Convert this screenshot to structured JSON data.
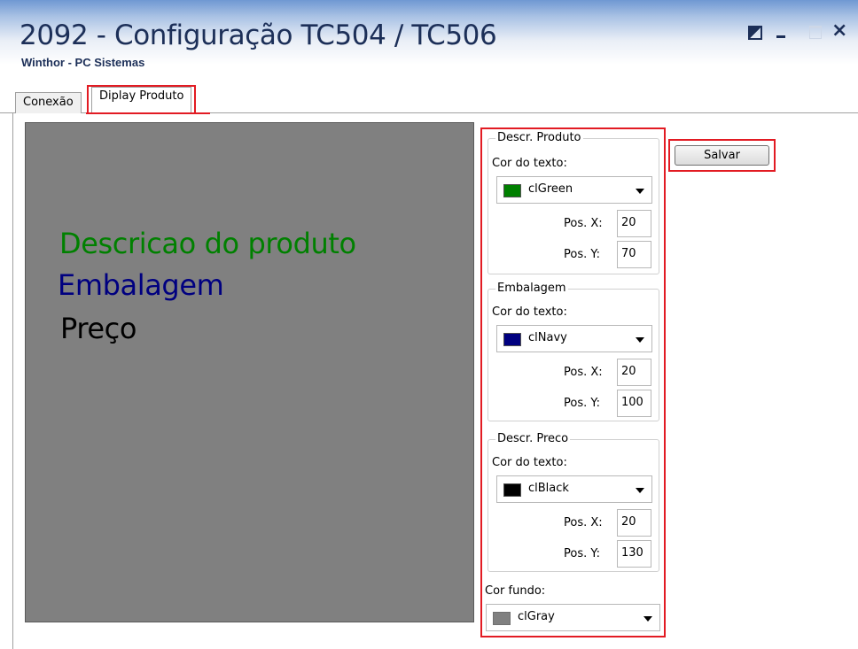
{
  "window": {
    "title": "2092 - Configuração TC504 / TC506",
    "subtitle": "Winthor - PC Sistemas"
  },
  "tabs": [
    {
      "label": "Conexão",
      "active": false
    },
    {
      "label": "Diplay Produto",
      "active": true
    }
  ],
  "preview": {
    "background_color": "#808080",
    "lines": [
      {
        "text": "Descricao do produto",
        "color": "#008000"
      },
      {
        "text": "Embalagem",
        "color": "#000080"
      },
      {
        "text": "Preço",
        "color": "#000000"
      }
    ]
  },
  "groups": [
    {
      "title": "Descr. Produto",
      "color_label": "Cor do texto:",
      "color_value": "clGreen",
      "color_hex": "#008000",
      "posx_label": "Pos. X:",
      "posx_value": "20",
      "posy_label": "Pos. Y:",
      "posy_value": "70"
    },
    {
      "title": "Embalagem",
      "color_label": "Cor do texto:",
      "color_value": "clNavy",
      "color_hex": "#000080",
      "posx_label": "Pos. X:",
      "posx_value": "20",
      "posy_label": "Pos. Y:",
      "posy_value": "100"
    },
    {
      "title": "Descr. Preco",
      "color_label": "Cor do texto:",
      "color_value": "clBlack",
      "color_hex": "#000000",
      "posx_label": "Pos. X:",
      "posx_value": "20",
      "posy_label": "Pos. Y:",
      "posy_value": "130"
    }
  ],
  "background": {
    "label": "Cor fundo:",
    "value": "clGray",
    "color_hex": "#808080"
  },
  "save_label": "Salvar",
  "highlight_color": "#e21b23"
}
